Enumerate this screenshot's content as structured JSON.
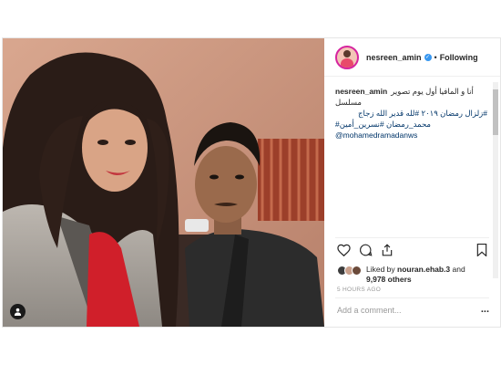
{
  "post": {
    "username": "nesreen_amin",
    "follow_label": "Following",
    "separator": "•",
    "caption": {
      "username": "nesreen_amin",
      "line1": "أنا و المافيا أول يوم تصوير مسلسل",
      "line2": "#زلزال رمضان ٢٠١٩ #لله قدير الله زجاج",
      "line3": "#محمد_رمضان #نسرين_أمين",
      "mention": "@mohamedramadanws"
    },
    "likes": {
      "prefix": "Liked by",
      "first_user": "nouran.ehab.3",
      "conjunction": "and",
      "others": "9,978 others"
    },
    "timestamp": "5 HOURS AGO",
    "comment_placeholder": "Add a comment...",
    "more_label": "..."
  },
  "icons": {
    "verified": "verified-badge-icon",
    "like": "heart-icon",
    "comment": "comment-icon",
    "share": "share-icon",
    "save": "bookmark-icon",
    "tag": "person-tag-icon"
  },
  "colors": {
    "verified": "#3897f0",
    "link": "#003569",
    "muted": "#999999",
    "border": "#efefef"
  }
}
